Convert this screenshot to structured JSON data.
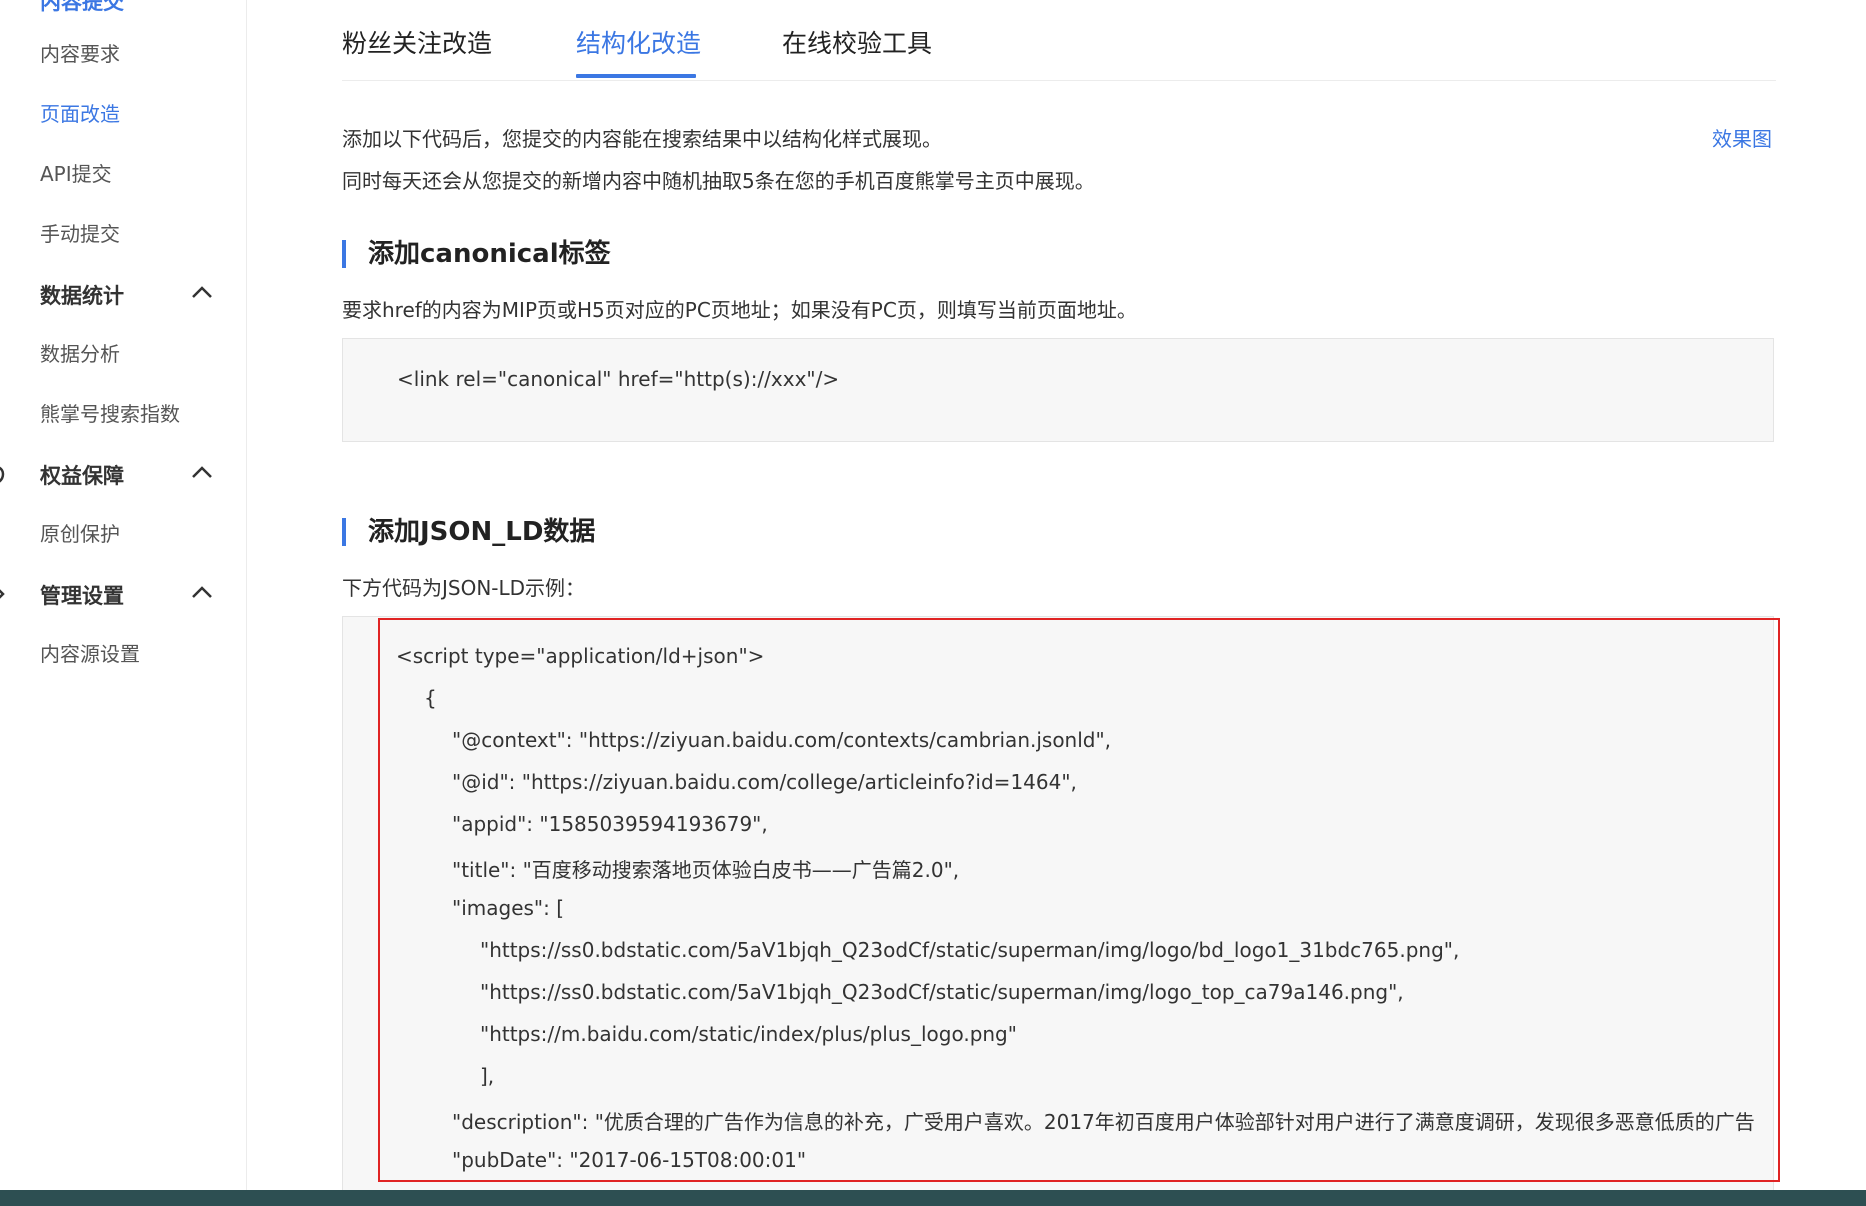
{
  "sidebar": {
    "top_cut_label": "内容提交",
    "items": [
      {
        "label": "内容要求",
        "active": false
      },
      {
        "label": "页面改造",
        "active": true
      },
      {
        "label": "API提交",
        "active": false
      },
      {
        "label": "手动提交",
        "active": false
      }
    ],
    "groups": [
      {
        "label": "数据统计",
        "icon": "chart-icon",
        "children": [
          "数据分析",
          "熊掌号搜索指数"
        ]
      },
      {
        "label": "权益保障",
        "icon": "shield-icon",
        "children": [
          "原创保护"
        ]
      },
      {
        "label": "管理设置",
        "icon": "gear-icon",
        "children": [
          "内容源设置"
        ]
      }
    ]
  },
  "tabs": [
    {
      "label": "粉丝关注改造",
      "active": false
    },
    {
      "label": "结构化改造",
      "active": true
    },
    {
      "label": "在线校验工具",
      "active": false
    }
  ],
  "intro": {
    "line1": "添加以下代码后，您提交的内容能在搜索结果中以结构化样式展现。",
    "line2": "同时每天还会从您提交的新增内容中随机抽取5条在您的手机百度熊掌号主页中展现。",
    "effect_link": "效果图"
  },
  "canonical_section": {
    "title": "添加canonical标签",
    "description": "要求href的内容为MIP页或H5页对应的PC页地址；如果没有PC页，则填写当前页面地址。",
    "code": "<link rel=\"canonical\" href=\"http(s)://xxx\"/>"
  },
  "jsonld_section": {
    "title": "添加JSON_LD数据",
    "description": "下方代码为JSON-LD示例：",
    "code_lines": [
      "<script type=\"application/ld+json\">",
      "{",
      "\"@context\": \"https://ziyuan.baidu.com/contexts/cambrian.jsonld\",",
      "\"@id\": \"https://ziyuan.baidu.com/college/articleinfo?id=1464\",",
      "\"appid\": \"1585039594193679\",",
      "\"title\": \"百度移动搜索落地页体验白皮书——广告篇2.0\",",
      "\"images\": [",
      "\"https://ss0.bdstatic.com/5aV1bjqh_Q23odCf/static/superman/img/logo/bd_logo1_31bdc765.png\",",
      "\"https://ss0.bdstatic.com/5aV1bjqh_Q23odCf/static/superman/img/logo_top_ca79a146.png\",",
      "\"https://m.baidu.com/static/index/plus/plus_logo.png\"",
      "],",
      "\"description\": \"优质合理的广告作为信息的补充，广受用户喜欢。2017年初百度用户体验部针对用户进行了满意度调研，发现很多恶意低质的广告",
      "\"pubDate\": \"2017-06-15T08:00:01\""
    ]
  },
  "colors": {
    "accent": "#3b77e3",
    "highlight_border": "#e02424",
    "code_bg": "#f7f7f7",
    "taskbar": "#2d4f52"
  }
}
